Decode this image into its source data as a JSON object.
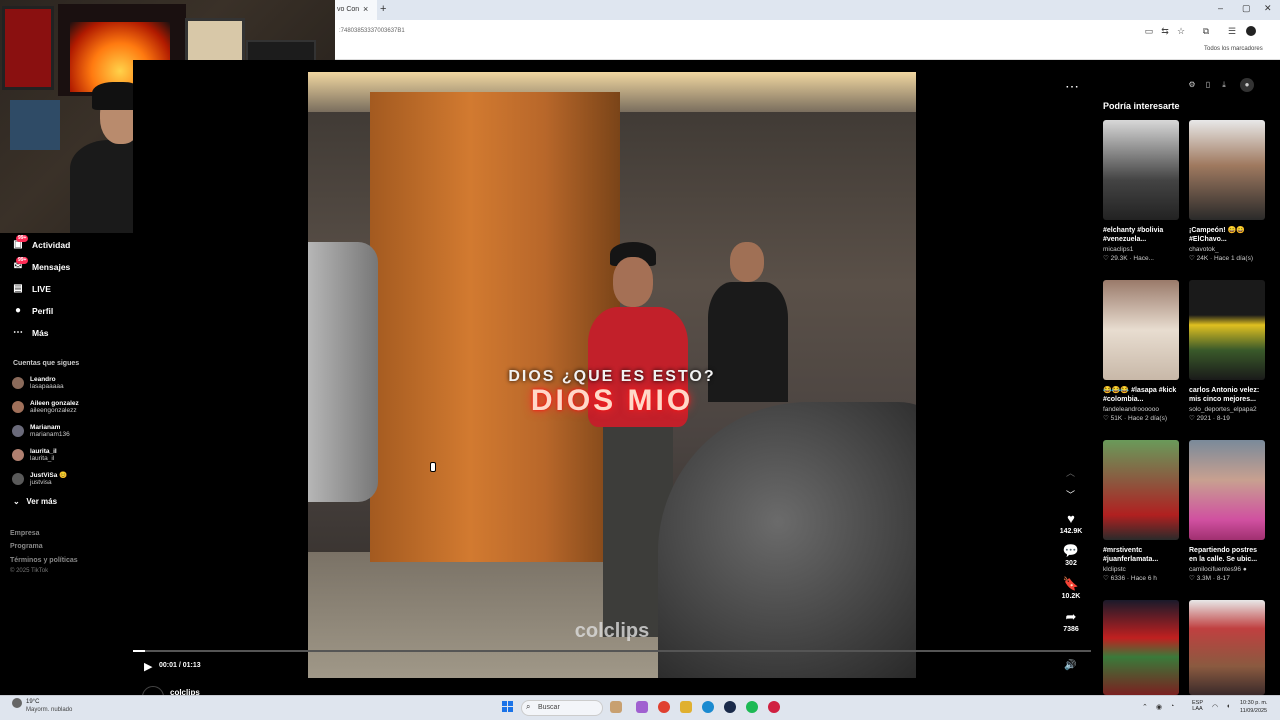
{
  "browser": {
    "tab_title": "vo Con",
    "new_tab_symbol": "+",
    "tab_close_symbol": "×",
    "url": ":74803853337003637B1",
    "bookmarks_label": "Todos los marcadores",
    "window_controls": [
      "–",
      "▢",
      "✕"
    ]
  },
  "sidebar": {
    "items": [
      {
        "label": "Actividad",
        "icon": "inbox-icon",
        "badge": "99+"
      },
      {
        "label": "Mensajes",
        "icon": "message-icon",
        "badge": "99+"
      },
      {
        "label": "LIVE",
        "icon": "live-icon"
      },
      {
        "label": "Perfil",
        "icon": "profile-icon"
      },
      {
        "label": "Más",
        "icon": "more-icon"
      }
    ],
    "following_title": "Cuentas que sigues",
    "accounts": [
      {
        "name": "Leandro",
        "handle": "lasapaaaaa"
      },
      {
        "name": "Aileen gonzalez",
        "handle": "aileengonzalezz"
      },
      {
        "name": "Marianam",
        "handle": "marianam136"
      },
      {
        "name": "laurita_il",
        "handle": "laurita_il"
      },
      {
        "name": "JustViSa 😊",
        "handle": "justvisa"
      }
    ],
    "see_more": "Ver más",
    "footer": [
      "Empresa",
      "Programa",
      "Términos y políticas"
    ],
    "copyright": "© 2025 TikTok"
  },
  "video": {
    "caption_top": "DIOS ¿QUE ES ESTO?",
    "caption_main": "DIOS MIO",
    "watermark": "colclips",
    "time": "00:01 / 01:13",
    "progress": 0.013,
    "author": "colclips",
    "actions": [
      {
        "icon": "heart-icon",
        "count": "142.9K"
      },
      {
        "icon": "comment-icon",
        "count": "302"
      },
      {
        "icon": "bookmark-icon",
        "count": "10.2K"
      },
      {
        "icon": "share-icon",
        "count": "7386"
      }
    ]
  },
  "recommended": {
    "title": "Podría interesarte",
    "cards": [
      {
        "desc": "#elchanty #bolivia #venezuela...",
        "user": "micaclips1",
        "meta": "♡ 29.3K · Hace..."
      },
      {
        "desc": "¡Campeón! 😄😄 #ElChavo...",
        "user": "chavotok_",
        "meta": "♡ 24K · Hace 1 día(s)"
      },
      {
        "desc": "😂😂😂 #lasapa #kick #colombia...",
        "user": "fandeleandroooooo",
        "meta": "♡ 51K · Hace 2 día(s)"
      },
      {
        "desc": "carlos Antonio velez: mis cinco mejores...",
        "user": "solo_deportes_elpapa2",
        "meta": "♡ 2921 · 8-19"
      },
      {
        "desc": "#mrstiventc #juanferlamata...",
        "user": "klclipstc",
        "meta": "♡ 6336 · Hace 6 h"
      },
      {
        "desc": "Repartiendo postres en la calle. Se ubic...",
        "user": "camilocifuentes96 ●",
        "meta": "♡ 3.3M · 8-17"
      },
      {
        "desc": "",
        "user": "",
        "meta": ""
      },
      {
        "desc": "",
        "user": "",
        "meta": ""
      }
    ]
  },
  "taskbar": {
    "weather_temp": "19°C",
    "weather_desc": "Mayorm. nublado",
    "search_placeholder": "Buscar",
    "lang_line1": "ESP",
    "lang_line2": "LAA",
    "clock_time": "10:30 p. m.",
    "clock_date": "11/09/2025"
  },
  "colors": {
    "accent": "#fe2c55",
    "background": "#000000",
    "taskbar": "#dfe5ee"
  }
}
